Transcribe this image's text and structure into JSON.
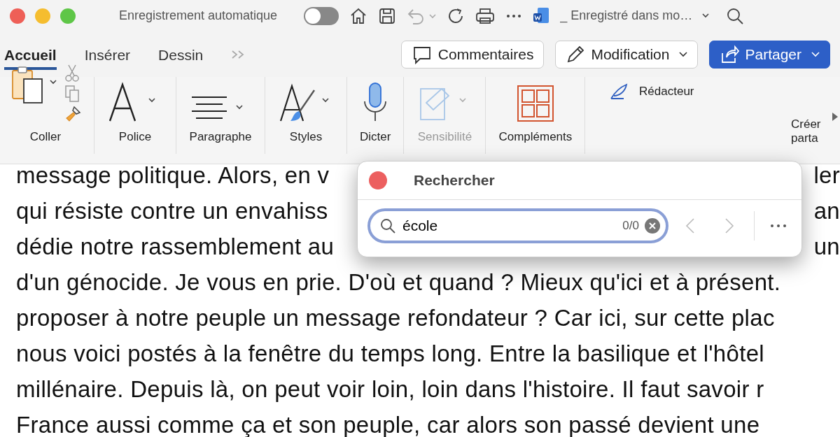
{
  "titlebar": {
    "autosave_label": "Enregistrement automatique",
    "autosave_on": false,
    "undo_disabled": true,
    "doc_title": "_ Enregistré dans mo…"
  },
  "tabs": [
    {
      "label": "Accueil",
      "selected": true
    },
    {
      "label": "Insérer",
      "selected": false
    },
    {
      "label": "Dessin",
      "selected": false
    }
  ],
  "header_buttons": [
    {
      "kind": "comments",
      "label": "Commentaires",
      "primary": false
    },
    {
      "kind": "edit",
      "label": "Modification",
      "primary": false
    },
    {
      "kind": "share",
      "label": "Partager",
      "primary": true
    }
  ],
  "ribbon": [
    {
      "kind": "paste",
      "label": "Coller",
      "disabled": false
    },
    {
      "kind": "font",
      "label": "Police",
      "disabled": false
    },
    {
      "kind": "paragraph",
      "label": "Paragraphe",
      "disabled": false
    },
    {
      "kind": "styles",
      "label": "Styles",
      "disabled": false
    },
    {
      "kind": "dictate",
      "label": "Dicter",
      "disabled": false
    },
    {
      "kind": "sensitivity",
      "label": "Sensibilité",
      "disabled": true
    },
    {
      "kind": "addins",
      "label": "Compléments",
      "disabled": false
    },
    {
      "kind": "editor",
      "label": "Rédacteur",
      "disabled": false
    },
    {
      "kind": "cut",
      "label": "Créer parta",
      "disabled": false
    }
  ],
  "find_panel": {
    "title": "Rechercher",
    "value": "école",
    "count": "0/0",
    "prev_disabled": true,
    "next_disabled": true
  },
  "document": {
    "lines": [
      {
        "text": "message politique. Alors, en v",
        "tail": "ler"
      },
      {
        "text": "qui résiste contre un envahiss",
        "tail": "an"
      },
      {
        "text": "dédie notre rassemblement au",
        "tail": "un"
      },
      {
        "text": "d'un génocide. Je vous en prie. D'où et quand ? Mieux qu'ici et à présent."
      },
      {
        "text": "proposer à notre peuple un message refondateur ? Car ici, sur cette plac"
      },
      {
        "text": "nous voici postés à la fenêtre du temps long. Entre la basilique et l'hôtel"
      },
      {
        "text": "millénaire. Depuis là, on peut voir loin, loin dans l'histoire. Il faut savoir r"
      },
      {
        "text": "France aussi comme ça et son peuple, car alors son passé devient une"
      }
    ]
  }
}
